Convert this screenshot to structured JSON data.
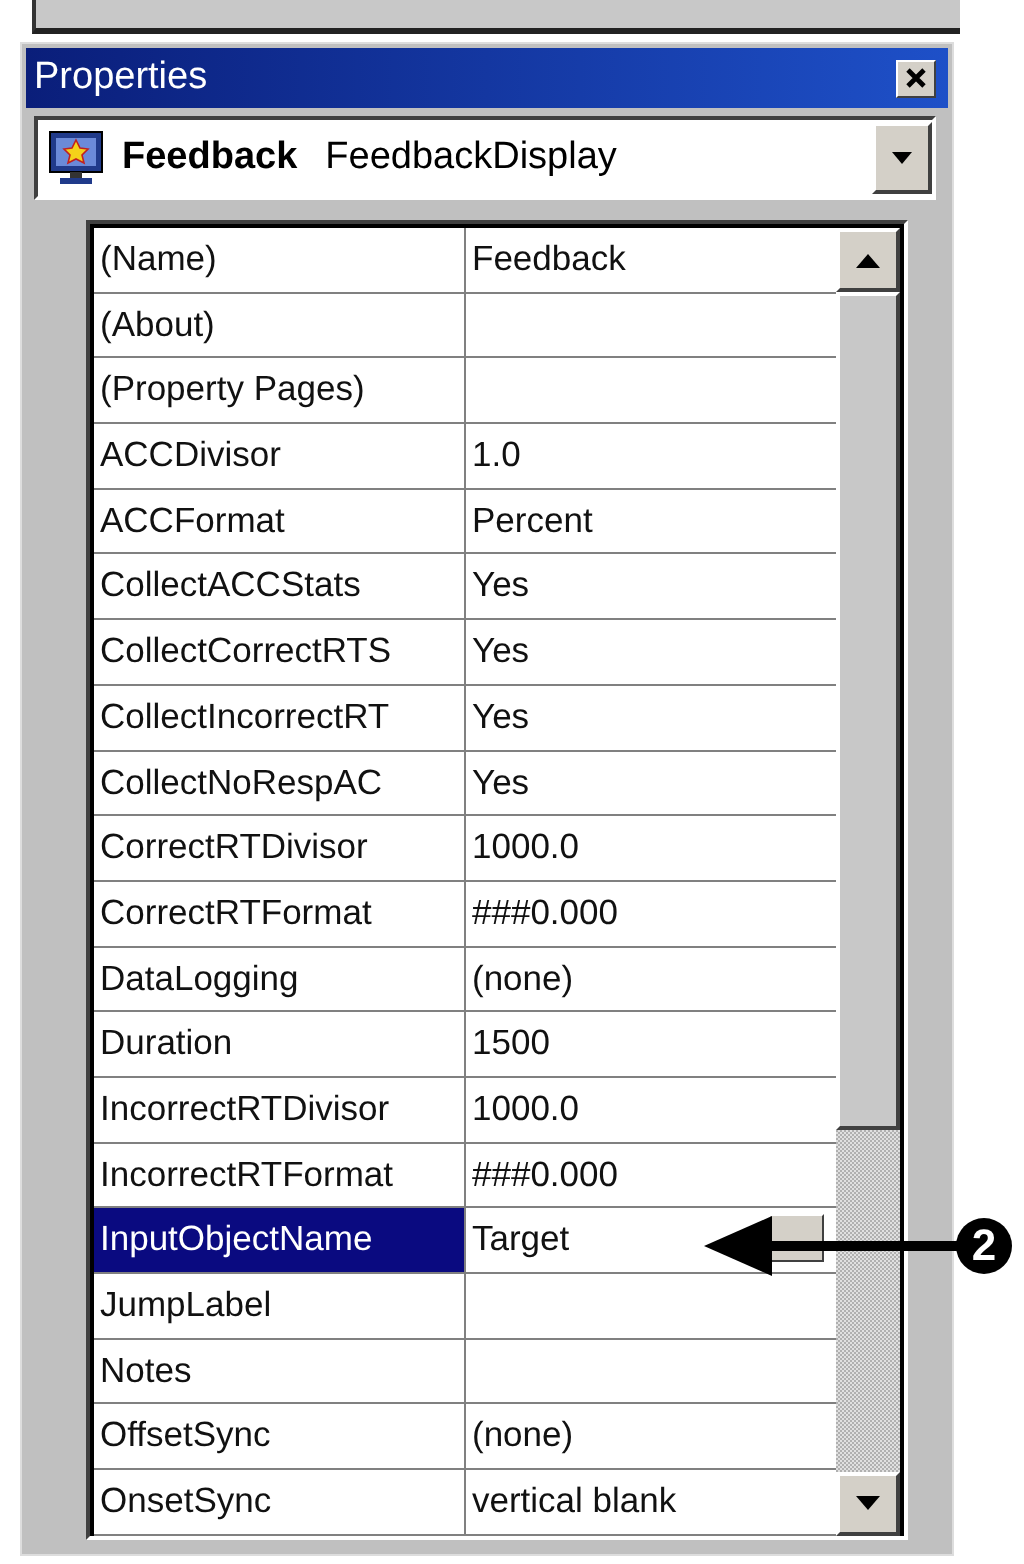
{
  "window": {
    "title": "Properties"
  },
  "object": {
    "name": "Feedback",
    "type": "FeedbackDisplay"
  },
  "properties": [
    {
      "name": "(Name)",
      "value": "Feedback",
      "selected": false
    },
    {
      "name": "(About)",
      "selected": false
    },
    {
      "name": "(Property Pages)",
      "selected": false
    },
    {
      "name": "ACCDivisor",
      "value": "1.0",
      "selected": false
    },
    {
      "name": "ACCFormat",
      "value": "Percent",
      "selected": false
    },
    {
      "name": "CollectACCStats",
      "value": "Yes",
      "selected": false
    },
    {
      "name": "CollectCorrectRTS",
      "value": "Yes",
      "selected": false
    },
    {
      "name": "CollectIncorrectRT",
      "value": "Yes",
      "selected": false
    },
    {
      "name": "CollectNoRespAC",
      "value": "Yes",
      "selected": false
    },
    {
      "name": "CorrectRTDivisor",
      "value": "1000.0",
      "selected": false
    },
    {
      "name": "CorrectRTFormat",
      "value": "###0.000",
      "selected": false
    },
    {
      "name": "DataLogging",
      "value": "(none)",
      "selected": false
    },
    {
      "name": "Duration",
      "value": "1500",
      "selected": false
    },
    {
      "name": "IncorrectRTDivisor",
      "value": "1000.0",
      "selected": false
    },
    {
      "name": "IncorrectRTFormat",
      "value": "###0.000",
      "selected": false
    },
    {
      "name": "InputObjectName",
      "value": "Target",
      "selected": true
    },
    {
      "name": "JumpLabel",
      "selected": false
    },
    {
      "name": "Notes",
      "selected": false
    },
    {
      "name": "OffsetSync",
      "value": "(none)",
      "selected": false
    },
    {
      "name": "OnsetSync",
      "value": "vertical blank",
      "selected": false
    }
  ],
  "callout": {
    "label": "2"
  }
}
